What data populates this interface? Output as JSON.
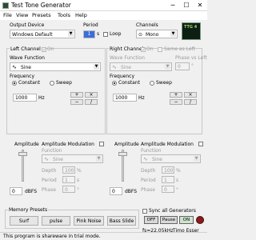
{
  "window": {
    "title": "Test Tone Generator",
    "minimize_label": "─",
    "maximize_label": "☐",
    "close_label": "✕"
  },
  "menu": {
    "items": [
      "File",
      "View",
      "Presets",
      "Tools",
      "Help"
    ]
  },
  "output_device": {
    "label": "Output Device",
    "value": "Windows Default"
  },
  "period": {
    "label": "Period",
    "value": "1",
    "loop_label": "Loop"
  },
  "channels": {
    "label": "Channels",
    "value": "Mono"
  },
  "logo": {
    "text": "TTG 4"
  },
  "left": {
    "channel_label": "Left Channel",
    "on_label": "On",
    "wave_label": "Wave Function",
    "wave_value": "Sine",
    "freq_label": "Frequency",
    "constant_label": "Constant",
    "sweep_label": "Sweep",
    "freq_value": "1000",
    "freq_unit": "Hz",
    "amp_label": "Amplitude",
    "amp_value": "0",
    "amp_unit": "dBFS",
    "am_label": "Amplitude Modulation",
    "function_label": "Function",
    "function_value": "Sine",
    "depth_label": "Depth",
    "depth_value": "100",
    "depth_unit": "%",
    "period_label": "Period",
    "period_value": "1",
    "period_unit": "s",
    "phase_label": "Phase",
    "phase_value": "0",
    "phase_unit": "°"
  },
  "right": {
    "channel_label": "Right Channel",
    "on_label": "On",
    "same_label": "Same as Left",
    "wave_label": "Wave Function",
    "wave_value": "Sine",
    "phase_vs_left_label": "Phase vs Left",
    "phase_vs_left_value": "0",
    "freq_label": "Frequency",
    "constant_label": "Constant",
    "sweep_label": "Sweep",
    "freq_value": "1000",
    "freq_unit": "Hz",
    "amp_label": "Amplitude",
    "amp_value": "0",
    "amp_unit": "dBFS",
    "am_label": "Amplitude Modulation",
    "function_label": "Function",
    "function_value": "Sine",
    "depth_label": "Depth",
    "depth_value": "100",
    "depth_unit": "%",
    "period_label": "Period",
    "period_value": "1",
    "period_unit": "s",
    "phase_label": "Phase",
    "phase_value": "0",
    "phase_unit": "°"
  },
  "freq_buttons": {
    "plus": "+",
    "minus": "−",
    "times": "×",
    "divide": "/"
  },
  "presets": {
    "label": "Memory Presets",
    "buttons": [
      "Surf",
      "pulse",
      "Pink Noise",
      "Bass Slide"
    ]
  },
  "sync": {
    "label": "Sync all Generators",
    "off": "OFF",
    "pause": "Pause",
    "on": "ON"
  },
  "status": {
    "text": "This program is shareware in trial mode.",
    "fs": "fs=22.05kHz",
    "credit": "Timo Esser"
  }
}
